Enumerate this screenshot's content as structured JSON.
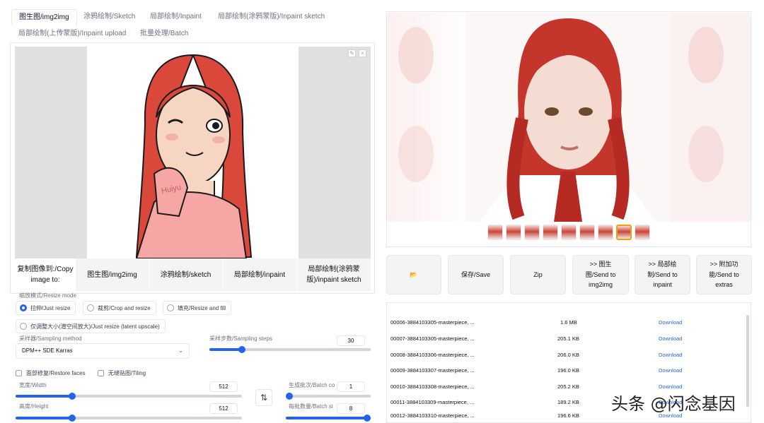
{
  "tabs": {
    "row1": [
      "图生图/img2img",
      "涂鸦绘制/Sketch",
      "局部绘制/Inpaint",
      "局部绘制(涂鸦蒙版)/Inpaint sketch"
    ],
    "row2": [
      "局部绘制(上传蒙版)/Inpaint upload",
      "批量处理/Batch"
    ]
  },
  "canvas": {
    "copy_label_1": "复制图像到:/Copy",
    "copy_label_2": "image to:",
    "btn_img2img": "图生图/img2img",
    "btn_sketch": "涂鸦绘制/sketch",
    "btn_inpaint": "局部绘制/inpaint",
    "btn_inpaint_sketch_1": "局部绘制(涂鸦蒙",
    "btn_inpaint_sketch_2": "版)/inpaint sketch",
    "image_text": "Huiyu"
  },
  "resize": {
    "label": "缩放模式/Resize mode",
    "options": [
      "拉伸/Just resize",
      "裁剪/Crop and resize",
      "填充/Resize and fill",
      "仅调整大小(潜空间放大)/Just resize (latent upscale)"
    ]
  },
  "sampler": {
    "label": "采样器/Sampling method",
    "value": "DPM++ SDE Karras"
  },
  "steps": {
    "label": "采样步数/Sampling steps",
    "value": "30",
    "fraction": 0.2
  },
  "restore_faces": "面部修复/Restore faces",
  "tiling": "无缝贴图/Tiling",
  "width": {
    "label": "宽度/Width",
    "value": "512",
    "fraction": 0.25
  },
  "height": {
    "label": "高度/Height",
    "value": "512",
    "fraction": 0.25
  },
  "batch_count": {
    "label": "生成批次/Batch co",
    "value": "1",
    "fraction": 0.0
  },
  "batch_size": {
    "label": "每批数量/Batch si",
    "value": "8",
    "fraction": 1.0
  },
  "swap_icon": "⇅",
  "actions": {
    "folder": "📂",
    "save": "保存/Save",
    "zip": "Zip",
    "send_img2img": [
      ">> 图生",
      "图/Send to",
      "img2img"
    ],
    "send_inpaint": [
      ">> 局部绘",
      "制/Send to",
      "inpaint"
    ],
    "send_extras": [
      ">> 附加功",
      "能/Send to",
      "extras"
    ]
  },
  "files": [
    {
      "name": "00006-3884103305-masterpiece, ...",
      "size": "1.6 MB",
      "link": "Download"
    },
    {
      "name": "00007-3884103305-masterpiece, ...",
      "size": "205.1 KB",
      "link": "Download"
    },
    {
      "name": "00008-3884103306-masterpiece, ...",
      "size": "206.0 KB",
      "link": "Download"
    },
    {
      "name": "00009-3884103307-masterpiece, ...",
      "size": "196.0 KB",
      "link": "Download"
    },
    {
      "name": "00010-3884103308-masterpiece, ...",
      "size": "205.2 KB",
      "link": "Download"
    },
    {
      "name": "00011-3884103309-masterpiece, ...",
      "size": "189.2 KB",
      "link": "Download"
    },
    {
      "name": "00012-3884103310-masterpiece, ...",
      "size": "196.6 KB",
      "link": "Download"
    }
  ],
  "watermark": "头条 @闪念基因",
  "colors": {
    "accent": "#2563eb",
    "hair": "#d9483b",
    "shirt": "#f7a6a6"
  }
}
